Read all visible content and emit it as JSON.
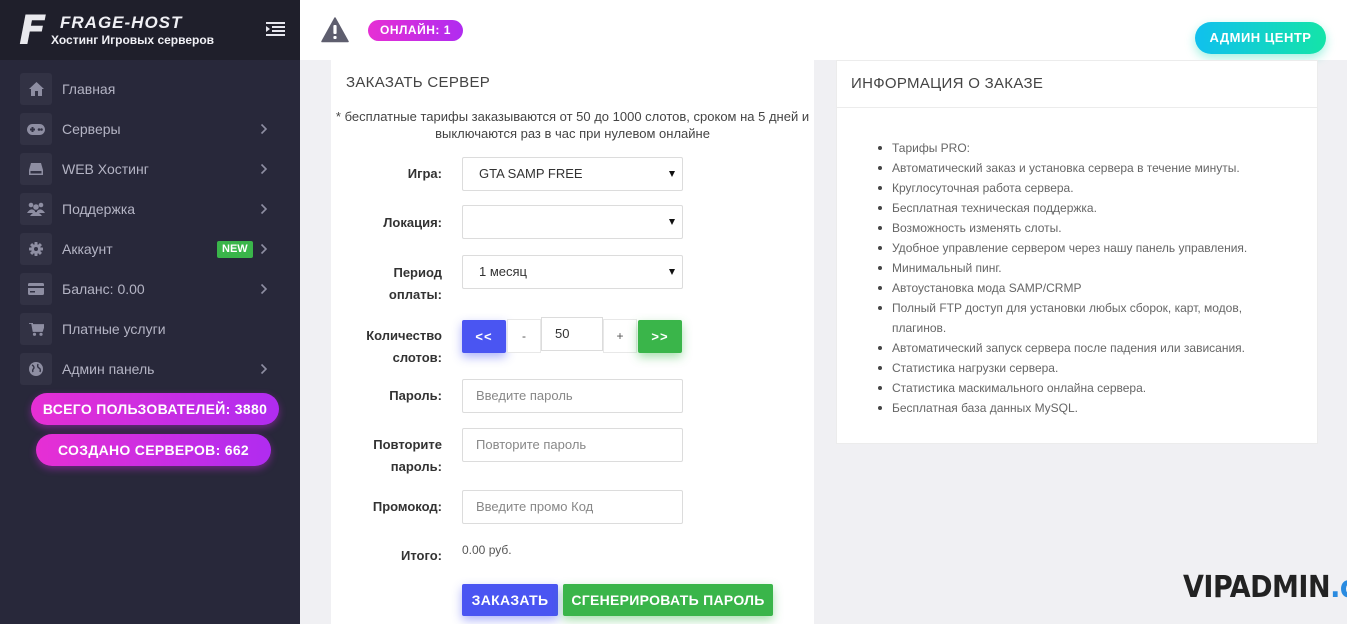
{
  "brand": {
    "letter": "F",
    "name": "FRAGE-HOST",
    "tagline": "Хостинг Игровых серверов"
  },
  "sidebar": {
    "items": [
      {
        "label": "Главная",
        "icon": "home-icon",
        "chevron": false
      },
      {
        "label": "Серверы",
        "icon": "gamepad-icon",
        "chevron": true
      },
      {
        "label": "WEB Хостинг",
        "icon": "hard-drive-icon",
        "chevron": true
      },
      {
        "label": "Поддержка",
        "icon": "users-icon",
        "chevron": true
      },
      {
        "label": "Аккаунт",
        "icon": "gear-icon",
        "chevron": true,
        "badge": "NEW"
      },
      {
        "label": "Баланс: 0.00",
        "icon": "credit-card-icon",
        "chevron": true
      },
      {
        "label": "Платные услуги",
        "icon": "cart-icon",
        "chevron": false
      },
      {
        "label": "Админ панель",
        "icon": "globe-icon",
        "chevron": true
      }
    ],
    "stats": {
      "users": "ВСЕГО ПОЛЬЗОВАТЕЛЕЙ: 3880",
      "servers": "СОЗДАНО СЕРВЕРОВ: 662"
    }
  },
  "topbar": {
    "online": "ОНЛАЙН: 1",
    "admin_button": "АДМИН ЦЕНТР"
  },
  "order": {
    "title": "ЗАКАЗАТЬ СЕРВЕР",
    "note": "* бесплатные тарифы заказываются от 50 до 1000 слотов, сроком на 5 дней и выключаются раз в час при нулевом онлайне",
    "game_label": "Игра:",
    "game_value": "GTA SAMP FREE",
    "location_label": "Локация:",
    "location_value": "",
    "period_label_1": "Период",
    "period_label_2": "оплаты:",
    "period_value": "1 месяц",
    "slots_label_1": "Количество",
    "slots_label_2": "слотов:",
    "slots_min": "<<",
    "slots_minus": "-",
    "slots_value": "50",
    "slots_plus": "+",
    "slots_max": ">>",
    "password_label": "Пароль:",
    "password_placeholder": "Введите пароль",
    "repeat_label_1": "Повторите",
    "repeat_label_2": "пароль:",
    "repeat_placeholder": "Повторите пароль",
    "promo_label": "Промокод:",
    "promo_placeholder": "Введите промо Код",
    "total_label": "Итого:",
    "total_value": "0.00 руб.",
    "order_button": "ЗАКАЗАТЬ",
    "generate_button": "СГЕНЕРИРОВАТЬ ПАРОЛЬ"
  },
  "info": {
    "title": "ИНФОРМАЦИЯ О ЗАКАЗЕ",
    "items": [
      "Тарифы PRO:",
      "Автоматический заказ и установка сервера в течение минуты.",
      "Круглосуточная работа сервера.",
      "Бесплатная техническая поддержка.",
      "Возможность изменять слоты.",
      "Удобное управление сервером через нашу панель управления.",
      "Минимальный пинг.",
      "Автоустановка мода SAMP/CRMP",
      "Полный FTP доступ для установки любых сборок, карт, модов, плагинов.",
      "Автоматический запуск сервера после падения или зависания.",
      "Статистика нагрузки сервера.",
      "Статистика маскимального онлайна сервера.",
      "Бесплатная база данных MySQL."
    ]
  },
  "watermark": {
    "main": "VIPADMIN",
    "suffix": ".club"
  },
  "colors": {
    "sidebar": "#28283a",
    "accent_pink": "#e62fd4",
    "accent_blue": "#4a55f2",
    "accent_green": "#3ab54a",
    "accent_cyan": "#10c0ee"
  }
}
